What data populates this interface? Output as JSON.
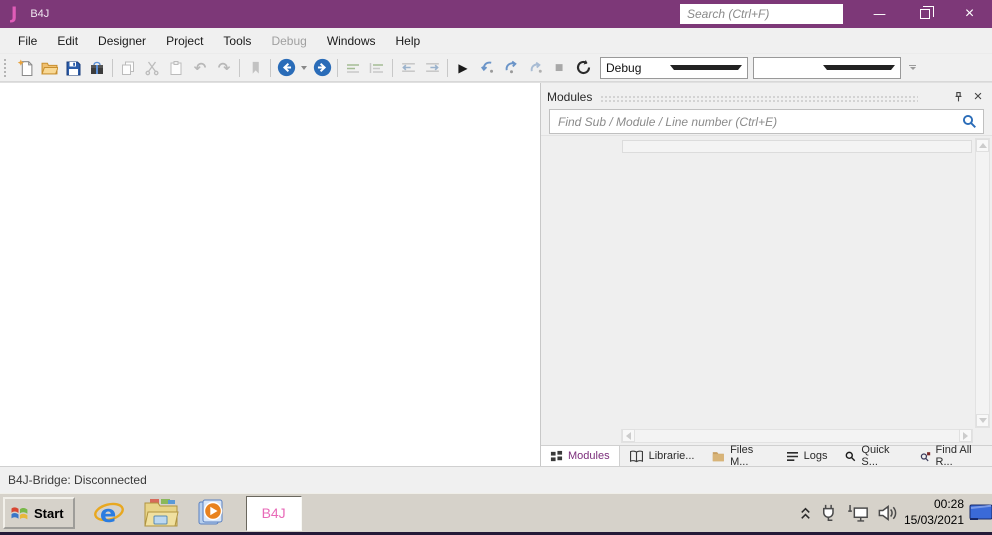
{
  "titlebar": {
    "logo": "J",
    "title": "B4J",
    "search_placeholder": "Search (Ctrl+F)"
  },
  "window_controls": {
    "minimize": "—",
    "close": "×"
  },
  "menu": {
    "items": [
      {
        "label": "File",
        "enabled": true
      },
      {
        "label": "Edit",
        "enabled": true
      },
      {
        "label": "Designer",
        "enabled": true
      },
      {
        "label": "Project",
        "enabled": true
      },
      {
        "label": "Tools",
        "enabled": true
      },
      {
        "label": "Debug",
        "enabled": false
      },
      {
        "label": "Windows",
        "enabled": true
      },
      {
        "label": "Help",
        "enabled": true
      }
    ]
  },
  "toolbar": {
    "debug_combo_value": "Debug",
    "config_combo_value": "",
    "run_glyph": "▶",
    "stop_glyph": "■",
    "undo_glyph": "↶",
    "redo_glyph": "↷"
  },
  "panel": {
    "title": "Modules",
    "search_placeholder": "Find Sub / Module / Line number (Ctrl+E)",
    "close_glyph": "×",
    "tabs": [
      {
        "label": "Modules",
        "active": true
      },
      {
        "label": "Librarie...",
        "active": false
      },
      {
        "label": "Files M...",
        "active": false
      },
      {
        "label": "Logs",
        "active": false
      },
      {
        "label": "Quick S...",
        "active": false
      },
      {
        "label": "Find All R...",
        "active": false
      }
    ]
  },
  "statusbar": {
    "text": "B4J-Bridge: Disconnected"
  },
  "taskbar": {
    "start_label": "Start",
    "app_button_label": "B4J",
    "clock_time": "00:28",
    "clock_date": "15/03/2021"
  },
  "colors": {
    "titlebar_bg": "#7d3878",
    "logo_pink": "#e05cb8",
    "accent_blue": "#2a6cb8",
    "active_tab_text": "#7b2d7b",
    "taskbar_bg": "#d6d2ca"
  }
}
